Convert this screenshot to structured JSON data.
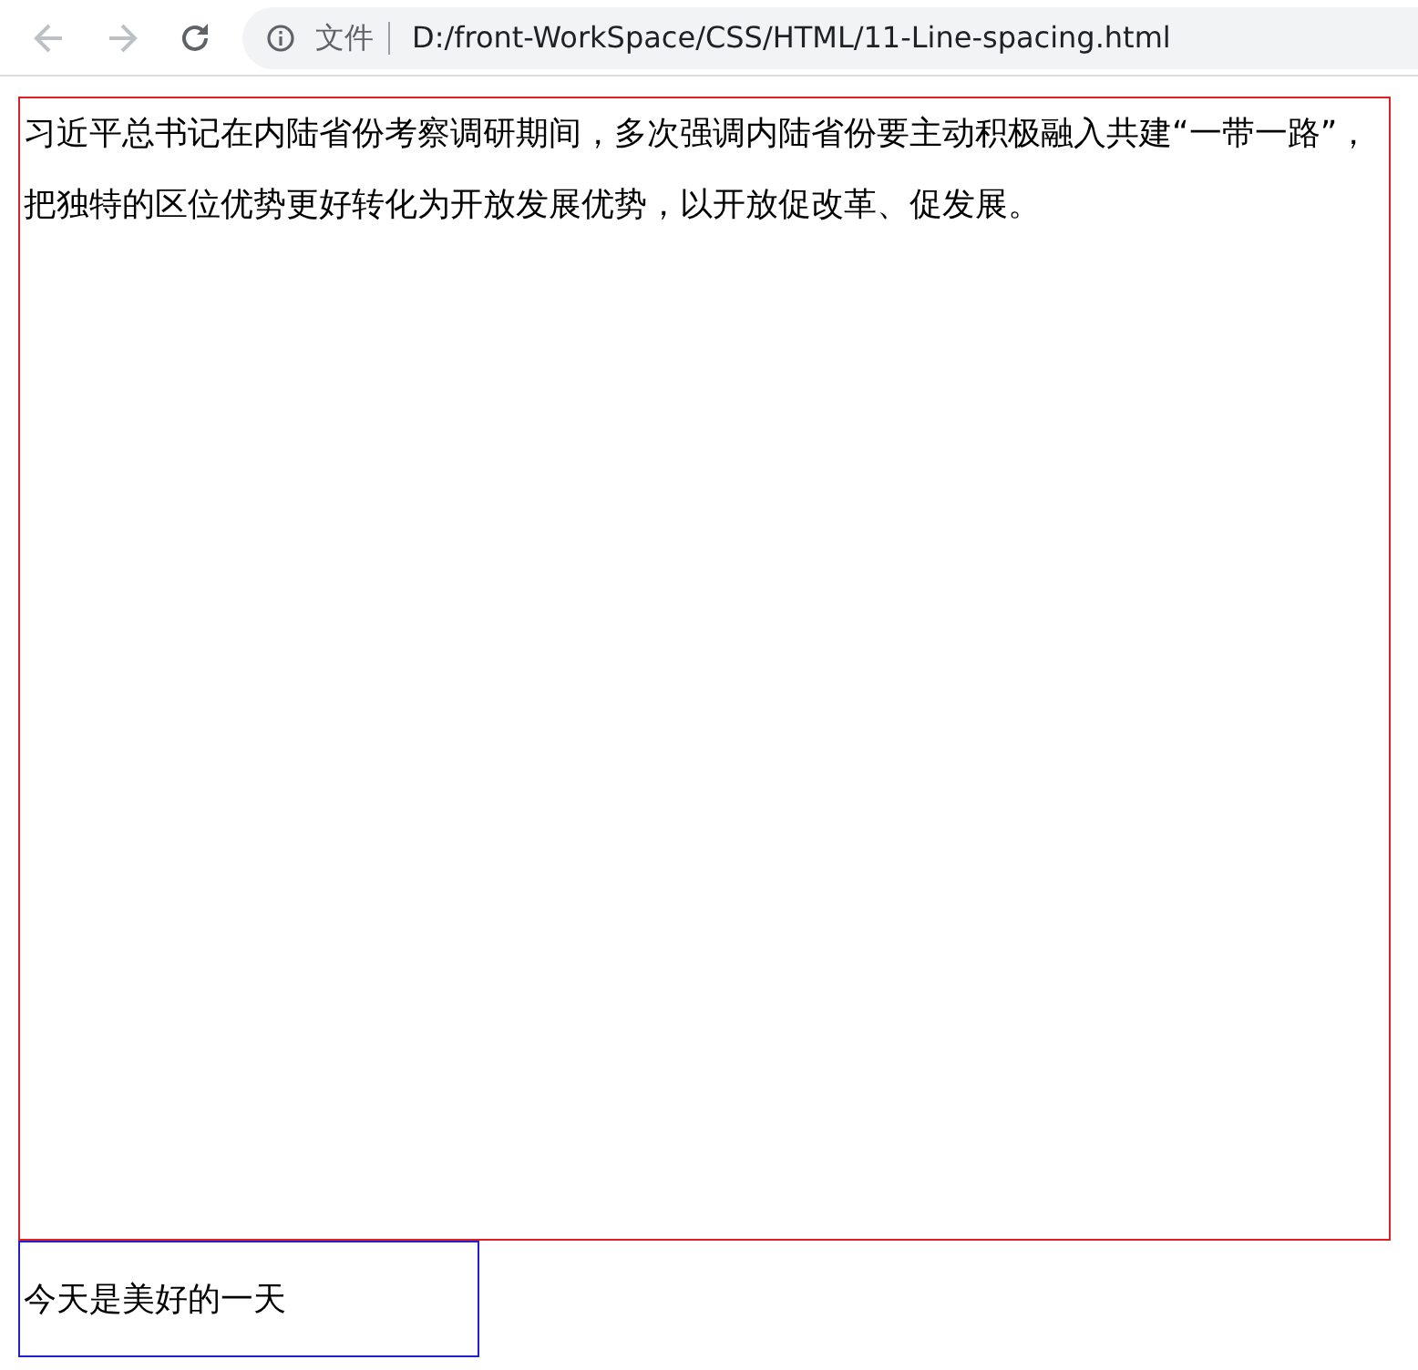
{
  "toolbar": {
    "back": {
      "disabled": true
    },
    "forward": {
      "disabled": true
    },
    "address": {
      "scheme_label": "文件",
      "url": "D:/front-WorkSpace/CSS/HTML/11-Line-spacing.html"
    }
  },
  "page": {
    "paragraph": "习近平总书记在内陆省份考察调研期间，多次强调内陆省份要主动积极融入共建“一带一路”，把独特的区位优势更好转化为开放发展优势，以开放促改革、促发展。",
    "second_box_text": "今天是美好的一天"
  }
}
